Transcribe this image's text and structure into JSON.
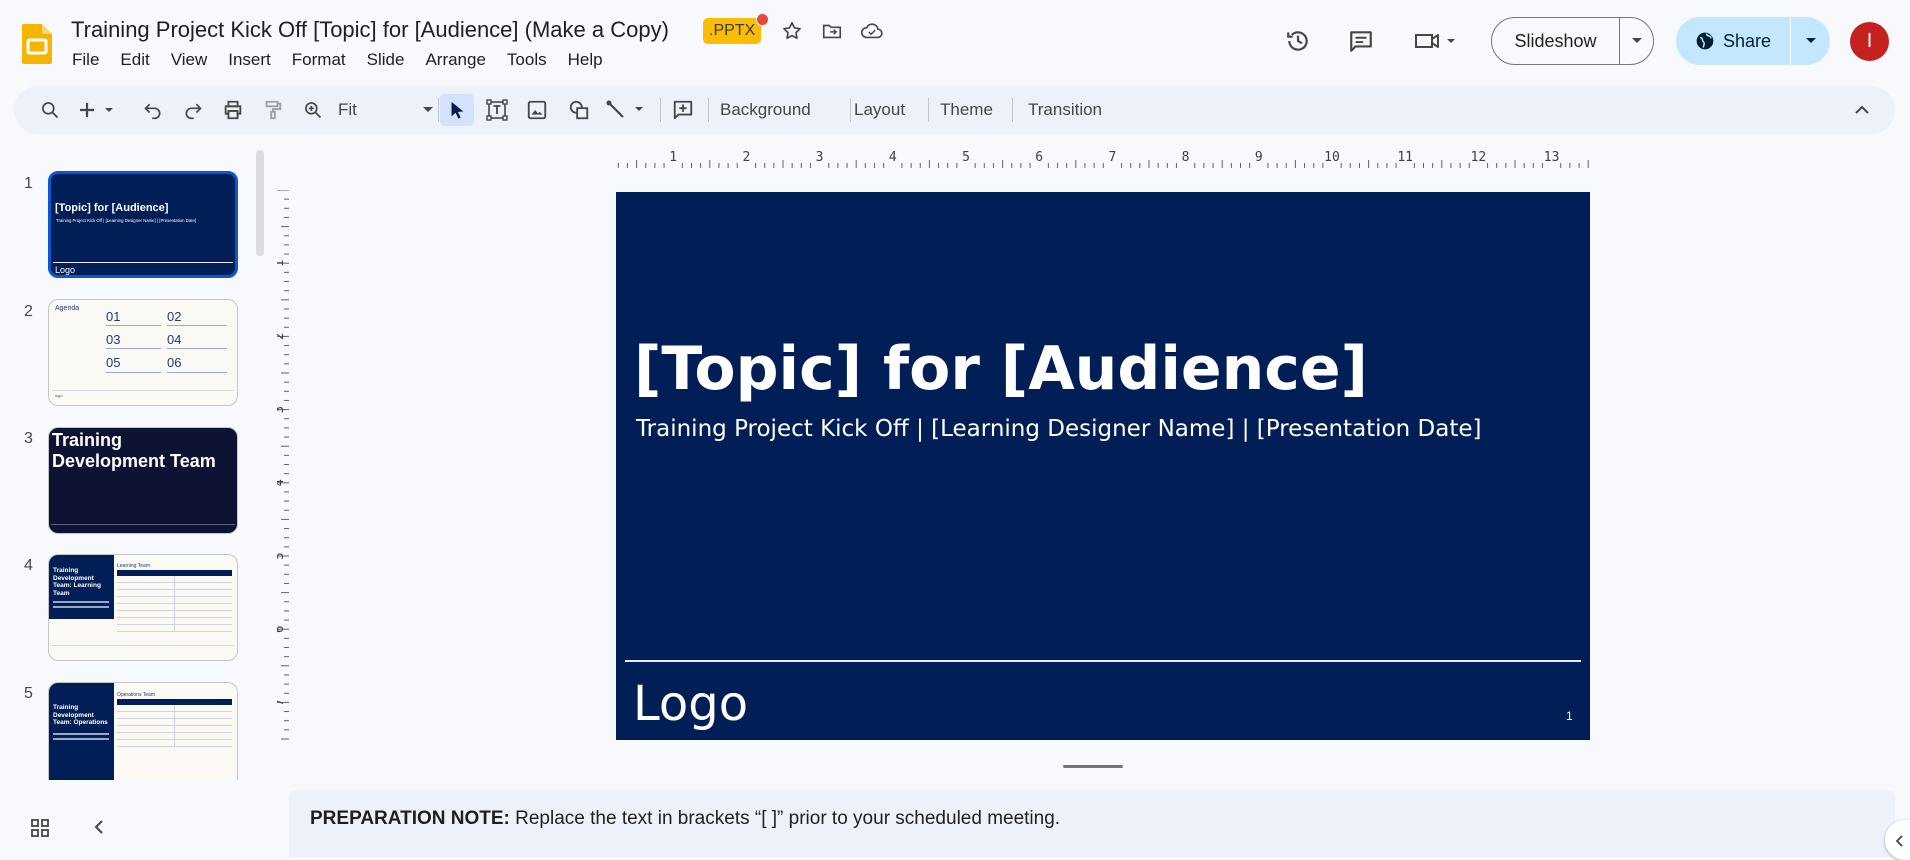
{
  "header": {
    "doc_title": "Training Project Kick Off [Topic] for [Audience] (Make a Copy)",
    "file_badge": ".PPTX",
    "menu": [
      "File",
      "Edit",
      "View",
      "Insert",
      "Format",
      "Slide",
      "Arrange",
      "Tools",
      "Help"
    ],
    "slideshow_label": "Slideshow",
    "share_label": "Share",
    "avatar_initial": "I"
  },
  "toolbar": {
    "zoom_label": "Fit",
    "background_label": "Background",
    "layout_label": "Layout",
    "theme_label": "Theme",
    "transition_label": "Transition"
  },
  "ruler": {
    "horizontal": [
      "1",
      "2",
      "3",
      "4",
      "5",
      "6",
      "7",
      "8",
      "9",
      "10",
      "11",
      "12",
      "13"
    ],
    "vertical": [
      "1",
      "2",
      "3",
      "4",
      "5",
      "6",
      "7"
    ]
  },
  "filmstrip": {
    "slides": [
      {
        "number": "1",
        "title": "[Topic] for [Audience]",
        "subtitle": "Training Project Kick Off | [Learning Designer Name] | [Presentation Date]",
        "logo": "Logo"
      },
      {
        "number": "2",
        "heading": "Agenda",
        "items": [
          "01",
          "02",
          "03",
          "04",
          "05",
          "06"
        ],
        "logo": "logo"
      },
      {
        "number": "3",
        "title": "Training Development Team"
      },
      {
        "number": "4",
        "title": "Training Development Team: Learning Team",
        "table_title": "Learning Team"
      },
      {
        "number": "5",
        "title": "Training Development Team: Operations",
        "table_title": "Operations Team"
      }
    ]
  },
  "slide": {
    "title": "[Topic] for [Audience]",
    "subtitle": "Training Project Kick Off | [Learning Designer Name] | [Presentation Date]",
    "logo": "Logo",
    "number": "1"
  },
  "notes": {
    "label": "PREPARATION NOTE:",
    "text": " Replace the text in brackets “[ ]” prior to your scheduled meeting."
  },
  "colors": {
    "slide_bg": "#011f56",
    "accent": "#0b57d0",
    "share_bg": "#c2e7ff",
    "badge": "#fbbc04",
    "avatar": "#c5221f"
  }
}
